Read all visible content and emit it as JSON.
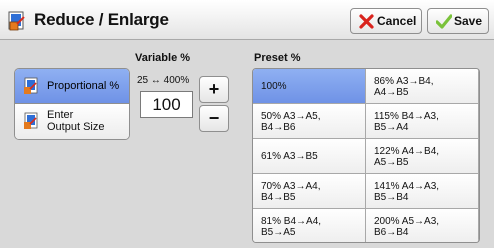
{
  "title": "Reduce / Enlarge",
  "buttons": {
    "cancel": "Cancel",
    "save": "Save"
  },
  "headers": {
    "variable": "Variable %",
    "preset": "Preset %"
  },
  "modes": [
    {
      "label": "Proportional %",
      "selected": true
    },
    {
      "label_line1": "Enter",
      "label_line2": "Output Size",
      "selected": false
    }
  ],
  "variable": {
    "range": "25 ↔ 400%",
    "value": "100",
    "plus": "+",
    "minus": "−"
  },
  "presets": [
    {
      "line1": "100%",
      "line2": "",
      "selected": true
    },
    {
      "line1": "86% A3→B4,",
      "line2": "A4→B5"
    },
    {
      "line1": "50% A3→A5,",
      "line2": "B4→B6"
    },
    {
      "line1": "115% B4→A3,",
      "line2": "B5→A4"
    },
    {
      "line1": "61% A3→B5",
      "line2": ""
    },
    {
      "line1": "122% A4→B4,",
      "line2": "A5→B5"
    },
    {
      "line1": "70% A3→A4,",
      "line2": "B4→B5"
    },
    {
      "line1": "141% A4→A3,",
      "line2": "B5→B4"
    },
    {
      "line1": "81% B4→A4,",
      "line2": "B5→A5"
    },
    {
      "line1": "200% A5→A3,",
      "line2": "B6→B4"
    }
  ],
  "colors": {
    "selected": "#7f9fee",
    "cancel_icon": "#d9231d",
    "save_icon": "#7ac23a"
  }
}
